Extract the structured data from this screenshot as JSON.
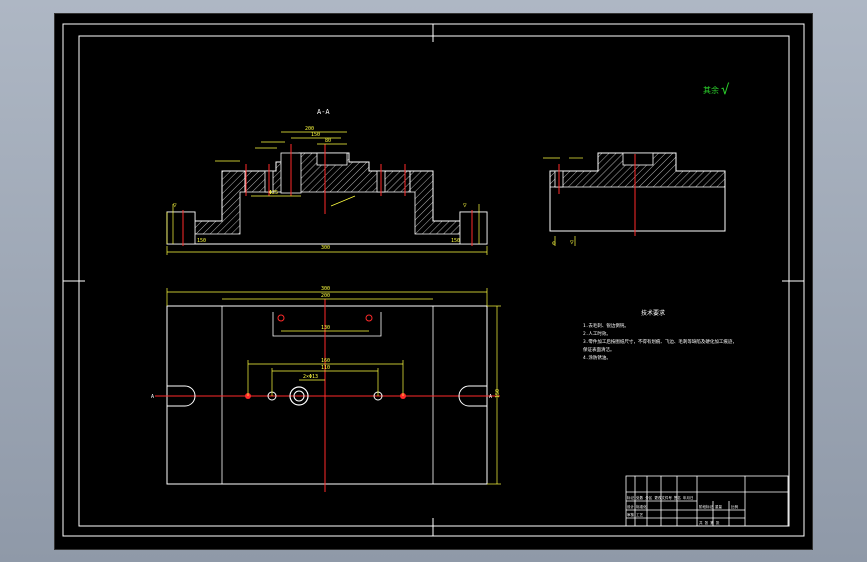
{
  "drawing": {
    "section_mark": "A-A",
    "roughness_note": "其余",
    "roughness_value": "√",
    "tech_requirements": {
      "title": "技术要求",
      "items": [
        "1.去毛刺、锐边倒钝。",
        "2.人工时效。",
        "3.零件加工后按图纸尺寸，不得有划痕、飞边、毛刺等缺陷及硬化加工痕迹，",
        "保证表面清洁。",
        "4.涂防锈油。"
      ]
    },
    "title_block": {
      "row1": "标记 处数  分区  更改文件号  签名  年月日",
      "row2": "设计          标准化",
      "row3": "审核          工艺",
      "stage_label": "阶段标记",
      "weight_label": "重量",
      "scale_label": "比例",
      "sheet_label": "共  张  第  张"
    },
    "dims": {
      "top_width": "300",
      "mid_width": "200",
      "hole_span": "150",
      "inner_span": "80",
      "bore": "Φ25",
      "height": "120",
      "plan_total": "300",
      "plan_inner": "200",
      "plan_slot": "130",
      "plan_row": "160",
      "plan_hole_pair": "110",
      "plan_height": "150",
      "plan_label": "2×Φ13"
    }
  }
}
